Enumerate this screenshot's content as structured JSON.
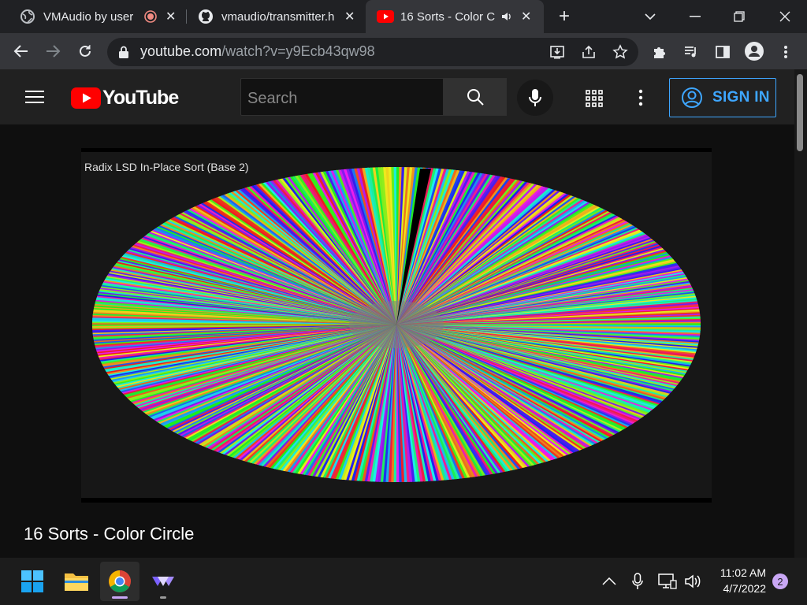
{
  "browser": {
    "tabs": [
      {
        "title": "VMAudio by user"
      },
      {
        "title": "vmaudio/transmitter.h"
      },
      {
        "title": "16 Sorts - Color C"
      }
    ],
    "url_host": "youtube.com",
    "url_path": "/watch?v=y9Ecb43qw98"
  },
  "youtube": {
    "logo_text": "YouTube",
    "search_placeholder": "Search",
    "sign_in_label": "SIGN IN"
  },
  "video": {
    "overlay_label": "Radix LSD In-Place Sort (Base 2)",
    "title": "16 Sorts - Color Circle"
  },
  "taskbar": {
    "time": "11:02 AM",
    "date": "4/7/2022",
    "notification_count": "2"
  },
  "colors": {
    "accent": "#3ea6ff",
    "youtube_red": "#ff0000"
  }
}
